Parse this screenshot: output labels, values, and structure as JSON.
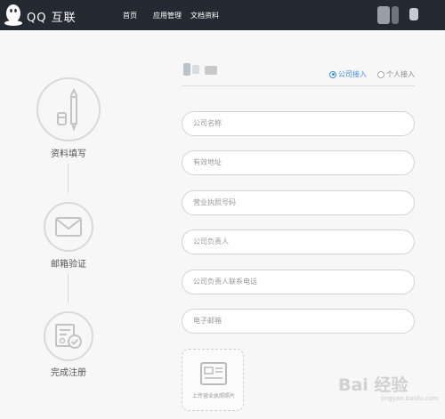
{
  "header": {
    "brand": "QQ 互联",
    "nav": [
      "首页",
      "应用管理",
      "文档资料"
    ]
  },
  "steps": [
    {
      "label": "资料填写",
      "icon": "pen-icon"
    },
    {
      "label": "邮箱验证",
      "icon": "envelope-icon"
    },
    {
      "label": "完成注册",
      "icon": "certificate-icon"
    }
  ],
  "form": {
    "options": [
      "公司接入",
      "个人接入"
    ],
    "selected_option": "公司接入",
    "fields": {
      "company_name": "公司名称",
      "address": "有效地址",
      "license_number": "营业执照号码",
      "manager": "公司负责人",
      "manager_phone": "公司负责人联系电话",
      "email": "电子邮箱"
    },
    "upload_label": "上传营业执照照片"
  },
  "watermark": {
    "text": "Bai 经验",
    "sub": "jingyan.baidu.com"
  },
  "colors": {
    "topbar": "#242a31",
    "accent": "#3b8ee6",
    "background": "#f7f7f7"
  }
}
